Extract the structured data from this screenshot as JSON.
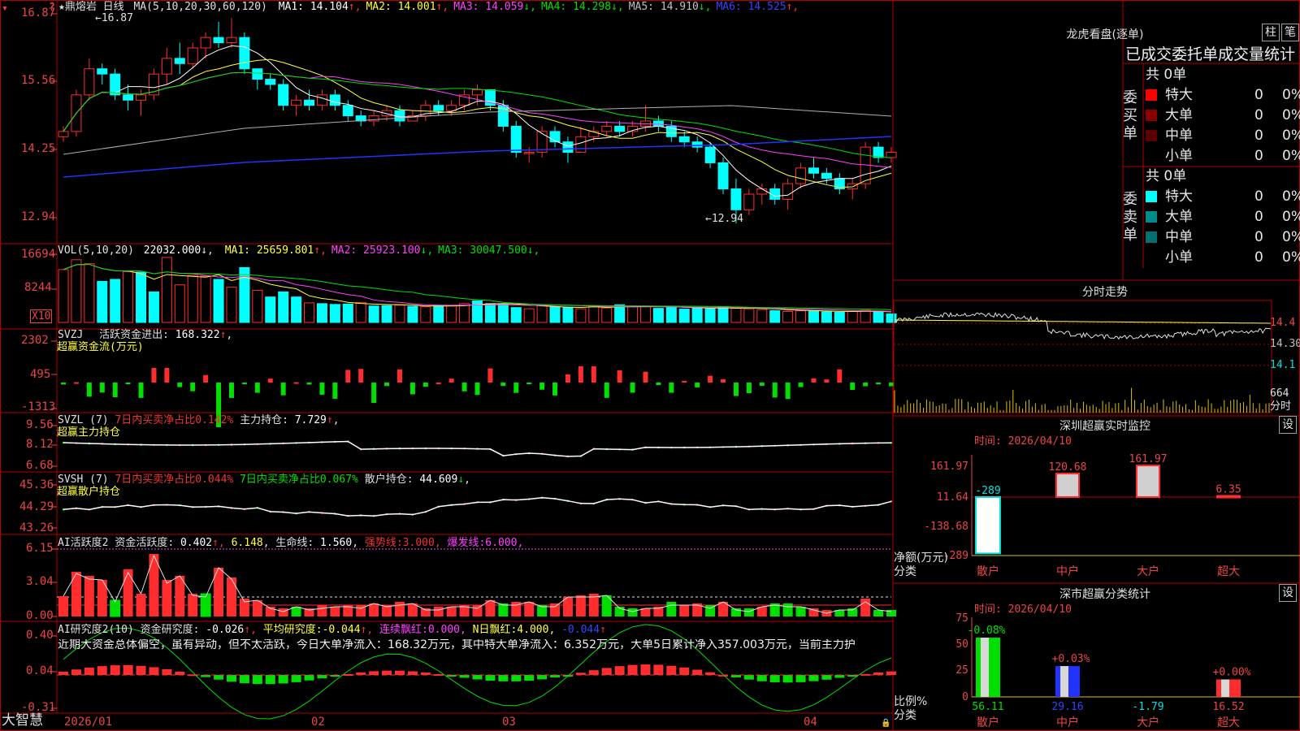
{
  "colors": {
    "up": "#ff2d2d",
    "down": "#00ffff",
    "green": "#00e000",
    "yellow": "#ffff40",
    "magenta": "#ff40ff",
    "blue": "#2233ff",
    "white": "#ffffff",
    "grey": "#b0b0b0",
    "bg": "#000000",
    "border": "#b00000"
  },
  "main": {
    "title": "★鼎熔岩 日线",
    "ma_header": "MA(5,10,20,30,60,120)",
    "ma": [
      {
        "label": "MA1:",
        "value": "14.104",
        "arrow": "↑",
        "color": "#ffffff"
      },
      {
        "label": "MA2:",
        "value": "14.001",
        "arrow": "↑",
        "color": "#ffff40"
      },
      {
        "label": "MA3:",
        "value": "14.059",
        "arrow": "↓",
        "color": "#ff40ff"
      },
      {
        "label": "MA4:",
        "value": "14.298",
        "arrow": "↓",
        "color": "#00e000"
      },
      {
        "label": "MA5:",
        "value": "14.910",
        "arrow": "↓",
        "color": "#c0c0c0"
      },
      {
        "label": "MA6:",
        "value": "14.525",
        "arrow": "↑",
        "color": "#3344ff"
      }
    ],
    "y_labels": [
      "16.87",
      "15.56",
      "14.25",
      "12.94"
    ],
    "high_mark": "16.87",
    "low_mark": "12.94"
  },
  "vol": {
    "header": "VOL(5,10,20)",
    "value": "22032.000",
    "ma": [
      {
        "label": "MA1:",
        "value": "25659.801",
        "arrow": "↑",
        "color": "#ffff40"
      },
      {
        "label": "MA2:",
        "value": "25923.100",
        "arrow": "↓",
        "color": "#ff40ff"
      },
      {
        "label": "MA3:",
        "value": "30047.500",
        "arrow": "↓",
        "color": "#00e000"
      }
    ],
    "y_labels": [
      "16694",
      "8244"
    ],
    "unit": "X10"
  },
  "svzj": {
    "header": "SVZJ",
    "label": "活跃资金进出:",
    "value": "168.322",
    "arrow": "↑",
    "sub": "超赢资金流(万元)",
    "y_labels": [
      "2302",
      "495",
      "-1313"
    ]
  },
  "svzl": {
    "header": "SVZL (7)",
    "ratio_label": "7日内买卖净占比",
    "ratio_value": "0.142%",
    "hold_label": "主力持仓:",
    "hold_value": "7.729",
    "sub": "超赢主力持仓",
    "y_labels": [
      "9.56",
      "8.12",
      "6.68"
    ]
  },
  "svsh": {
    "header": "SVSH (7)",
    "ratio1_label": "7日内买卖净占比",
    "ratio1_value": "0.044%",
    "ratio2_label": "7日内买卖净占比",
    "ratio2_value": "0.067%",
    "hold_label": "散户持仓:",
    "hold_value": "44.609",
    "sub": "超赢散户持仓",
    "y_labels": [
      "45.36",
      "44.29",
      "43.26"
    ]
  },
  "ai_active": {
    "header": "AI活跃度2",
    "label": "资金活跃度:",
    "value": "0.402",
    "v2": "6.148",
    "life_label": "生命线:",
    "life_value": "1.560",
    "strong_label": "强势线:",
    "strong_value": "3.000",
    "burst_label": "爆发线:",
    "burst_value": "6.000",
    "y_labels": [
      "6.15",
      "3.04",
      "0.00"
    ]
  },
  "ai_research": {
    "header": "AI研究度2(10)",
    "label": "资金研究度:",
    "value": "-0.026",
    "avg_label": "平均研究度:",
    "avg_value": "-0.044",
    "cont_label": "连续飘红:",
    "cont_value": "0.000",
    "n_label": "N日飘红:",
    "n_value": "4.000",
    "last": "-0.044",
    "text": "近期大资金总体偏空，虽有异动，但不太活跃，今日大单净流入：168.32万元，其中特大单净流入：6.352万元，大单5日累计净入357.003万元，当前主力护",
    "y_labels": [
      "0.40",
      "0.04",
      "-0.31"
    ]
  },
  "dates": [
    "2026/01",
    "02",
    "03",
    "04"
  ],
  "brand": "大智慧",
  "right": {
    "longhu": {
      "title": "龙虎看盘(逐单)",
      "btn1": "柱",
      "btn2": "笔",
      "header": "已成交委托单成交量统计",
      "buy": {
        "side_label": "委买单",
        "total": "共 0单",
        "rows": [
          {
            "name": "特大",
            "count": "0",
            "pct": "0%",
            "color": "#ff0000"
          },
          {
            "name": "大单",
            "count": "0",
            "pct": "0%",
            "color": "#8a0000"
          },
          {
            "name": "中单",
            "count": "0",
            "pct": "0%",
            "color": "#5a0000"
          },
          {
            "name": "小单",
            "count": "0",
            "pct": "0%",
            "color": "#000000"
          }
        ]
      },
      "sell": {
        "side_label": "委卖单",
        "total": "共 0单",
        "rows": [
          {
            "name": "特大",
            "count": "0",
            "pct": "0%",
            "color": "#00ffff"
          },
          {
            "name": "大单",
            "count": "0",
            "pct": "0%",
            "color": "#008b8b"
          },
          {
            "name": "中单",
            "count": "0",
            "pct": "0%",
            "color": "#007070"
          },
          {
            "name": "小单",
            "count": "0",
            "pct": "0%",
            "color": "#000000"
          }
        ]
      }
    },
    "intraday": {
      "title": "分时走势",
      "y_labels": [
        "14.4",
        "14.30",
        "14.1"
      ],
      "vol_label": "664",
      "vol_unit": "分时"
    },
    "sz_monitor": {
      "title": "深圳超赢实时监控",
      "btn": "设",
      "time": "时间: 2026/04/10",
      "y_labels": [
        "161.97",
        "11.64",
        "-138.68",
        "-289"
      ],
      "y_unit": "净额(万元)",
      "x_label": "分类",
      "categories": [
        "散户",
        "中户",
        "大户",
        "超大"
      ],
      "values": [
        -289,
        120.68,
        161.97,
        6.35
      ],
      "value_labels": [
        "-289",
        "120.68",
        "161.97",
        "6.35"
      ]
    },
    "sz_class": {
      "title": "深市超赢分类统计",
      "btn": "设",
      "time": "时间: 2026/04/10",
      "y_labels": [
        "75",
        "50",
        "25",
        "0"
      ],
      "y_unit": "比例%",
      "x_label": "分类",
      "categories": [
        "散户",
        "中户",
        "大户",
        "超大"
      ],
      "values": [
        56.11,
        29.16,
        -1.79,
        16.52
      ],
      "value_labels": [
        "56.11",
        "29.16",
        "-1.79",
        "16.52"
      ],
      "change_labels": [
        "-0.08%",
        "+0.03%",
        "",
        "+0.00%"
      ]
    }
  },
  "chart_data": [
    {
      "type": "candlestick",
      "title": "鼎熔岩 日线",
      "ylim": [
        12.8,
        17.0
      ],
      "ohlc": [
        [
          14.6,
          14.8,
          14.5,
          14.7
        ],
        [
          14.7,
          15.5,
          14.6,
          15.4
        ],
        [
          15.4,
          16.1,
          15.3,
          15.9
        ],
        [
          15.9,
          16.0,
          15.6,
          15.8
        ],
        [
          15.8,
          15.9,
          15.3,
          15.4
        ],
        [
          15.4,
          15.6,
          15.1,
          15.3
        ],
        [
          15.3,
          15.5,
          15.0,
          15.4
        ],
        [
          15.4,
          15.9,
          15.3,
          15.8
        ],
        [
          15.8,
          16.3,
          15.6,
          16.1
        ],
        [
          16.1,
          16.4,
          15.8,
          16.0
        ],
        [
          16.0,
          16.4,
          15.9,
          16.3
        ],
        [
          16.3,
          16.6,
          16.1,
          16.5
        ],
        [
          16.5,
          16.8,
          16.3,
          16.4
        ],
        [
          16.4,
          16.87,
          16.3,
          16.5
        ],
        [
          16.5,
          16.6,
          15.8,
          15.9
        ],
        [
          15.9,
          15.9,
          15.5,
          15.7
        ],
        [
          15.7,
          15.8,
          15.5,
          15.6
        ],
        [
          15.6,
          15.7,
          15.1,
          15.2
        ],
        [
          15.2,
          15.4,
          15.0,
          15.3
        ],
        [
          15.3,
          15.5,
          15.1,
          15.2
        ],
        [
          15.2,
          15.5,
          15.1,
          15.4
        ],
        [
          15.4,
          15.5,
          15.1,
          15.2
        ],
        [
          15.2,
          15.3,
          14.9,
          15.0
        ],
        [
          15.0,
          15.1,
          14.8,
          14.9
        ],
        [
          14.9,
          15.1,
          14.8,
          15.0
        ],
        [
          15.0,
          15.2,
          14.9,
          15.1
        ],
        [
          15.1,
          15.2,
          14.8,
          14.9
        ],
        [
          14.9,
          15.1,
          14.9,
          15.0
        ],
        [
          15.0,
          15.3,
          14.9,
          15.2
        ],
        [
          15.2,
          15.3,
          15.0,
          15.1
        ],
        [
          15.1,
          15.3,
          15.0,
          15.2
        ],
        [
          15.2,
          15.5,
          15.1,
          15.4
        ],
        [
          15.4,
          15.6,
          15.2,
          15.5
        ],
        [
          15.5,
          15.5,
          15.1,
          15.2
        ],
        [
          15.2,
          15.3,
          14.7,
          14.8
        ],
        [
          14.8,
          14.9,
          14.2,
          14.3
        ],
        [
          14.3,
          14.4,
          14.1,
          14.3
        ],
        [
          14.3,
          14.8,
          14.2,
          14.7
        ],
        [
          14.7,
          14.8,
          14.4,
          14.5
        ],
        [
          14.5,
          14.6,
          14.1,
          14.3
        ],
        [
          14.3,
          14.8,
          14.3,
          14.6
        ],
        [
          14.6,
          14.8,
          14.5,
          14.7
        ],
        [
          14.7,
          14.9,
          14.6,
          14.8
        ],
        [
          14.8,
          14.9,
          14.6,
          14.7
        ],
        [
          14.7,
          14.9,
          14.6,
          14.8
        ],
        [
          14.8,
          15.2,
          14.7,
          14.9
        ],
        [
          14.9,
          15.0,
          14.7,
          14.8
        ],
        [
          14.8,
          14.9,
          14.5,
          14.6
        ],
        [
          14.6,
          14.7,
          14.4,
          14.5
        ],
        [
          14.5,
          14.6,
          14.3,
          14.4
        ],
        [
          14.4,
          14.5,
          14.0,
          14.1
        ],
        [
          14.1,
          14.2,
          13.5,
          13.6
        ],
        [
          13.6,
          13.8,
          12.94,
          13.2
        ],
        [
          13.2,
          13.6,
          13.1,
          13.5
        ],
        [
          13.5,
          13.7,
          13.3,
          13.6
        ],
        [
          13.6,
          13.7,
          13.3,
          13.4
        ],
        [
          13.4,
          13.8,
          13.2,
          13.7
        ],
        [
          13.7,
          14.1,
          13.6,
          14.0
        ],
        [
          14.0,
          14.2,
          13.8,
          13.9
        ],
        [
          13.9,
          14.0,
          13.7,
          13.8
        ],
        [
          13.8,
          13.9,
          13.5,
          13.6
        ],
        [
          13.6,
          13.8,
          13.4,
          13.7
        ],
        [
          13.7,
          14.5,
          13.6,
          14.4
        ],
        [
          14.4,
          14.5,
          14.1,
          14.2
        ],
        [
          14.2,
          14.4,
          14.1,
          14.3
        ]
      ]
    },
    {
      "type": "bar",
      "title": "VOL",
      "values": [
        13500,
        16000,
        15000,
        10500,
        11000,
        13000,
        12800,
        7800,
        16600,
        9600,
        12000,
        11800,
        11000,
        9000,
        14000,
        8200,
        6500,
        7800,
        6500,
        5000,
        4800,
        4600,
        4700,
        5100,
        4200,
        4300,
        4400,
        4100,
        4000,
        4200,
        4300,
        4800,
        5500,
        4800,
        4700,
        3800,
        3500,
        4300,
        4000,
        3900,
        3500,
        4200,
        3700,
        4500,
        4200,
        4100,
        3600,
        4000,
        3400,
        3800,
        3500,
        4000,
        3600,
        3500,
        3300,
        3000,
        2800,
        3000,
        3000,
        2700,
        2600,
        2800,
        3100,
        2900,
        2200
      ],
      "up": [
        1,
        1,
        1,
        0,
        0,
        1,
        0,
        0,
        1,
        1,
        1,
        1,
        0,
        1,
        0,
        1,
        0,
        0,
        0,
        1,
        0,
        0,
        0,
        1,
        0,
        0,
        1,
        0,
        1,
        0,
        1,
        1,
        0,
        0,
        0,
        0,
        1,
        1,
        0,
        0,
        1,
        1,
        1,
        0,
        1,
        1,
        0,
        0,
        0,
        0,
        0,
        0,
        1,
        1,
        1,
        0,
        1,
        1,
        0,
        0,
        0,
        1,
        1,
        0,
        0
      ]
    }
  ]
}
